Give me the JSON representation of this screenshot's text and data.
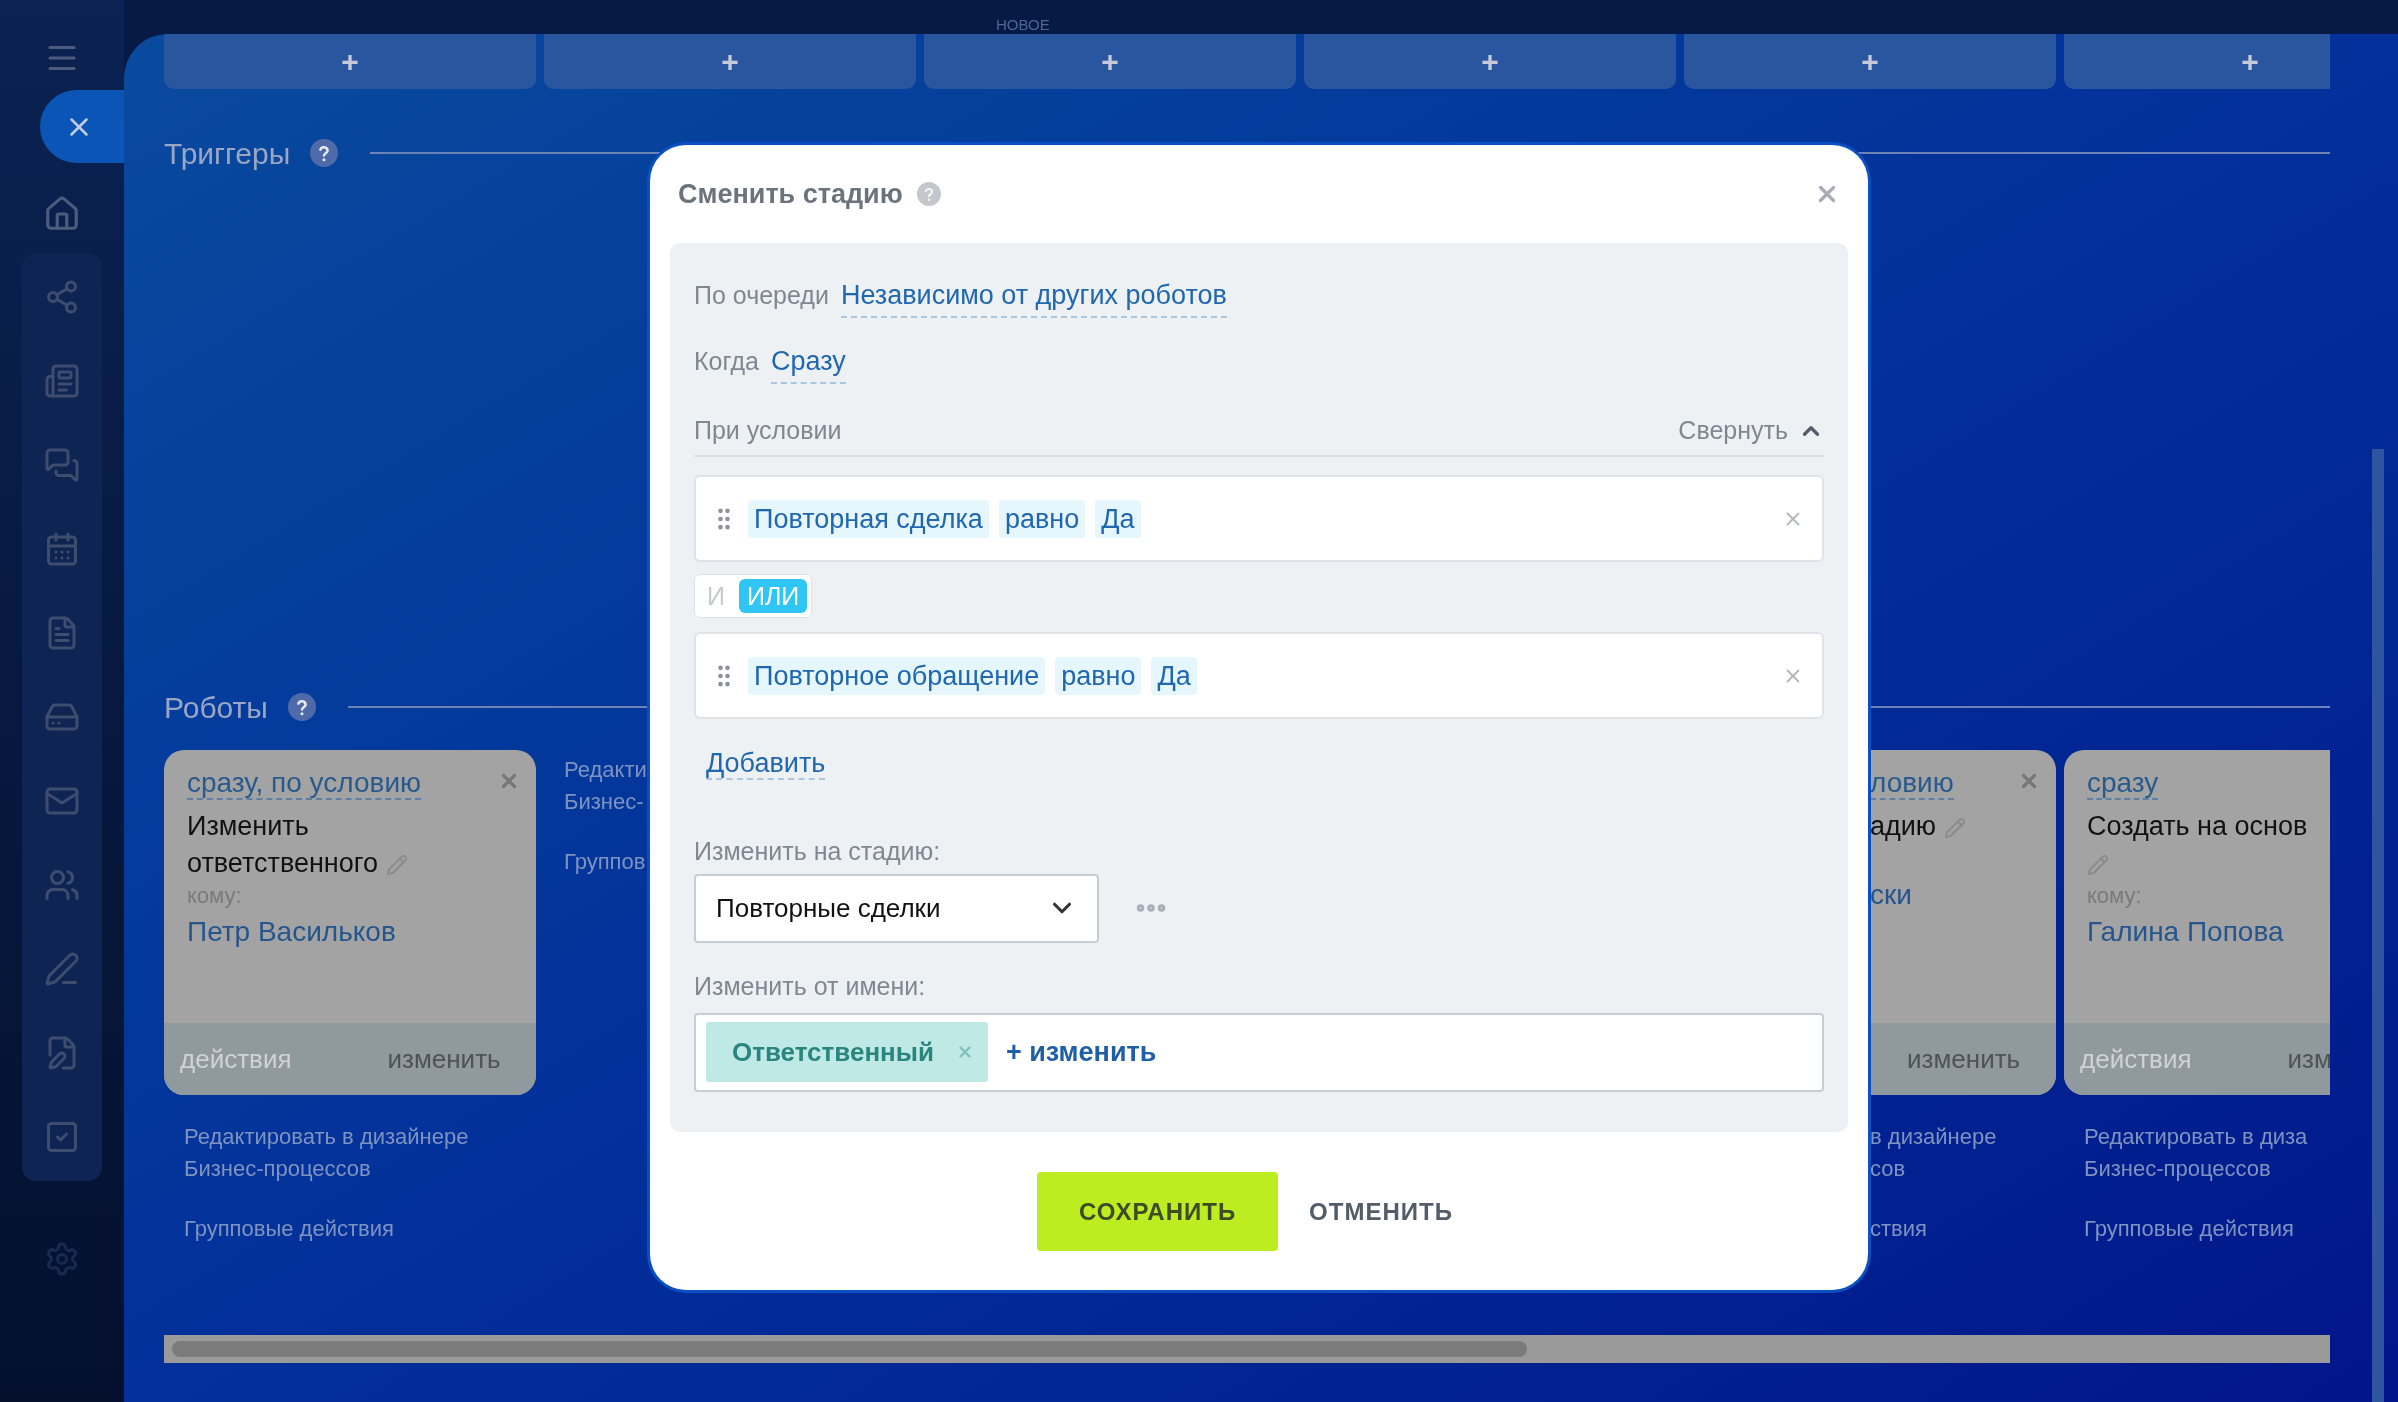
{
  "columns_bar": {
    "new_label": "НОВОЕ",
    "buttons": [
      "+",
      "+",
      "+",
      "+",
      "+",
      "+"
    ]
  },
  "triggers": {
    "title": "Триггеры"
  },
  "robots": {
    "title": "Роботы",
    "columns": [
      {
        "kind": "card",
        "card": {
          "condition": "сразу, по условию",
          "action": "Изменить ответственного",
          "to_label": "кому:",
          "assignee": "Петр Васильков",
          "footer_left": "действия",
          "footer_right": "изменить",
          "closable": true
        },
        "links": [
          [
            "Редактировать в дизайнере",
            "Бизнес-процессов"
          ],
          [
            "Групповые действия"
          ]
        ]
      },
      {
        "kind": "links",
        "links": [
          [
            "Редакти",
            "Бизнес-"
          ],
          [
            "Группов"
          ]
        ]
      },
      {
        "kind": "hidden"
      },
      {
        "kind": "hidden"
      },
      {
        "kind": "partial",
        "card": {
          "condition": "ловию",
          "action": "адию",
          "assignee": "ски",
          "footer_right": "изменить",
          "closable": true
        },
        "links": [
          [
            "в дизайнере",
            "сов"
          ],
          [
            "ствия"
          ]
        ]
      },
      {
        "kind": "card",
        "card": {
          "condition": "сразу",
          "action": "Создать на основ",
          "to_label": "кому:",
          "assignee": "Галина Попова",
          "footer_left": "действия",
          "footer_right": "изм"
        },
        "links": [
          [
            "Редактировать в диза",
            "Бизнес-процессов"
          ],
          [
            "Групповые действия"
          ]
        ]
      }
    ]
  },
  "dialog": {
    "title": "Сменить стадию",
    "order": {
      "label": "По очереди",
      "value": "Независимо от других роботов"
    },
    "when": {
      "label": "Когда",
      "value": "Сразу"
    },
    "condition": {
      "label": "При условии",
      "collapse": "Свернуть",
      "expanded": true,
      "rules": [
        {
          "field": "Повторная сделка",
          "operator": "равно",
          "value": "Да"
        },
        {
          "field": "Повторное обращение",
          "operator": "равно",
          "value": "Да"
        }
      ],
      "joiners": [
        {
          "label": "И",
          "selected": false
        },
        {
          "label": "ИЛИ",
          "selected": true
        }
      ],
      "add": "Добавить"
    },
    "stage": {
      "label": "Изменить на стадию:",
      "value": "Повторные сделки"
    },
    "on_behalf": {
      "label": "Изменить от имени:",
      "chips": [
        "Ответственный"
      ],
      "change": "+ изменить"
    },
    "buttons": [
      {
        "label": "СОХРАНИТЬ",
        "kind": "primary"
      },
      {
        "label": "ОТМЕНИТЬ",
        "kind": "link"
      }
    ]
  }
}
